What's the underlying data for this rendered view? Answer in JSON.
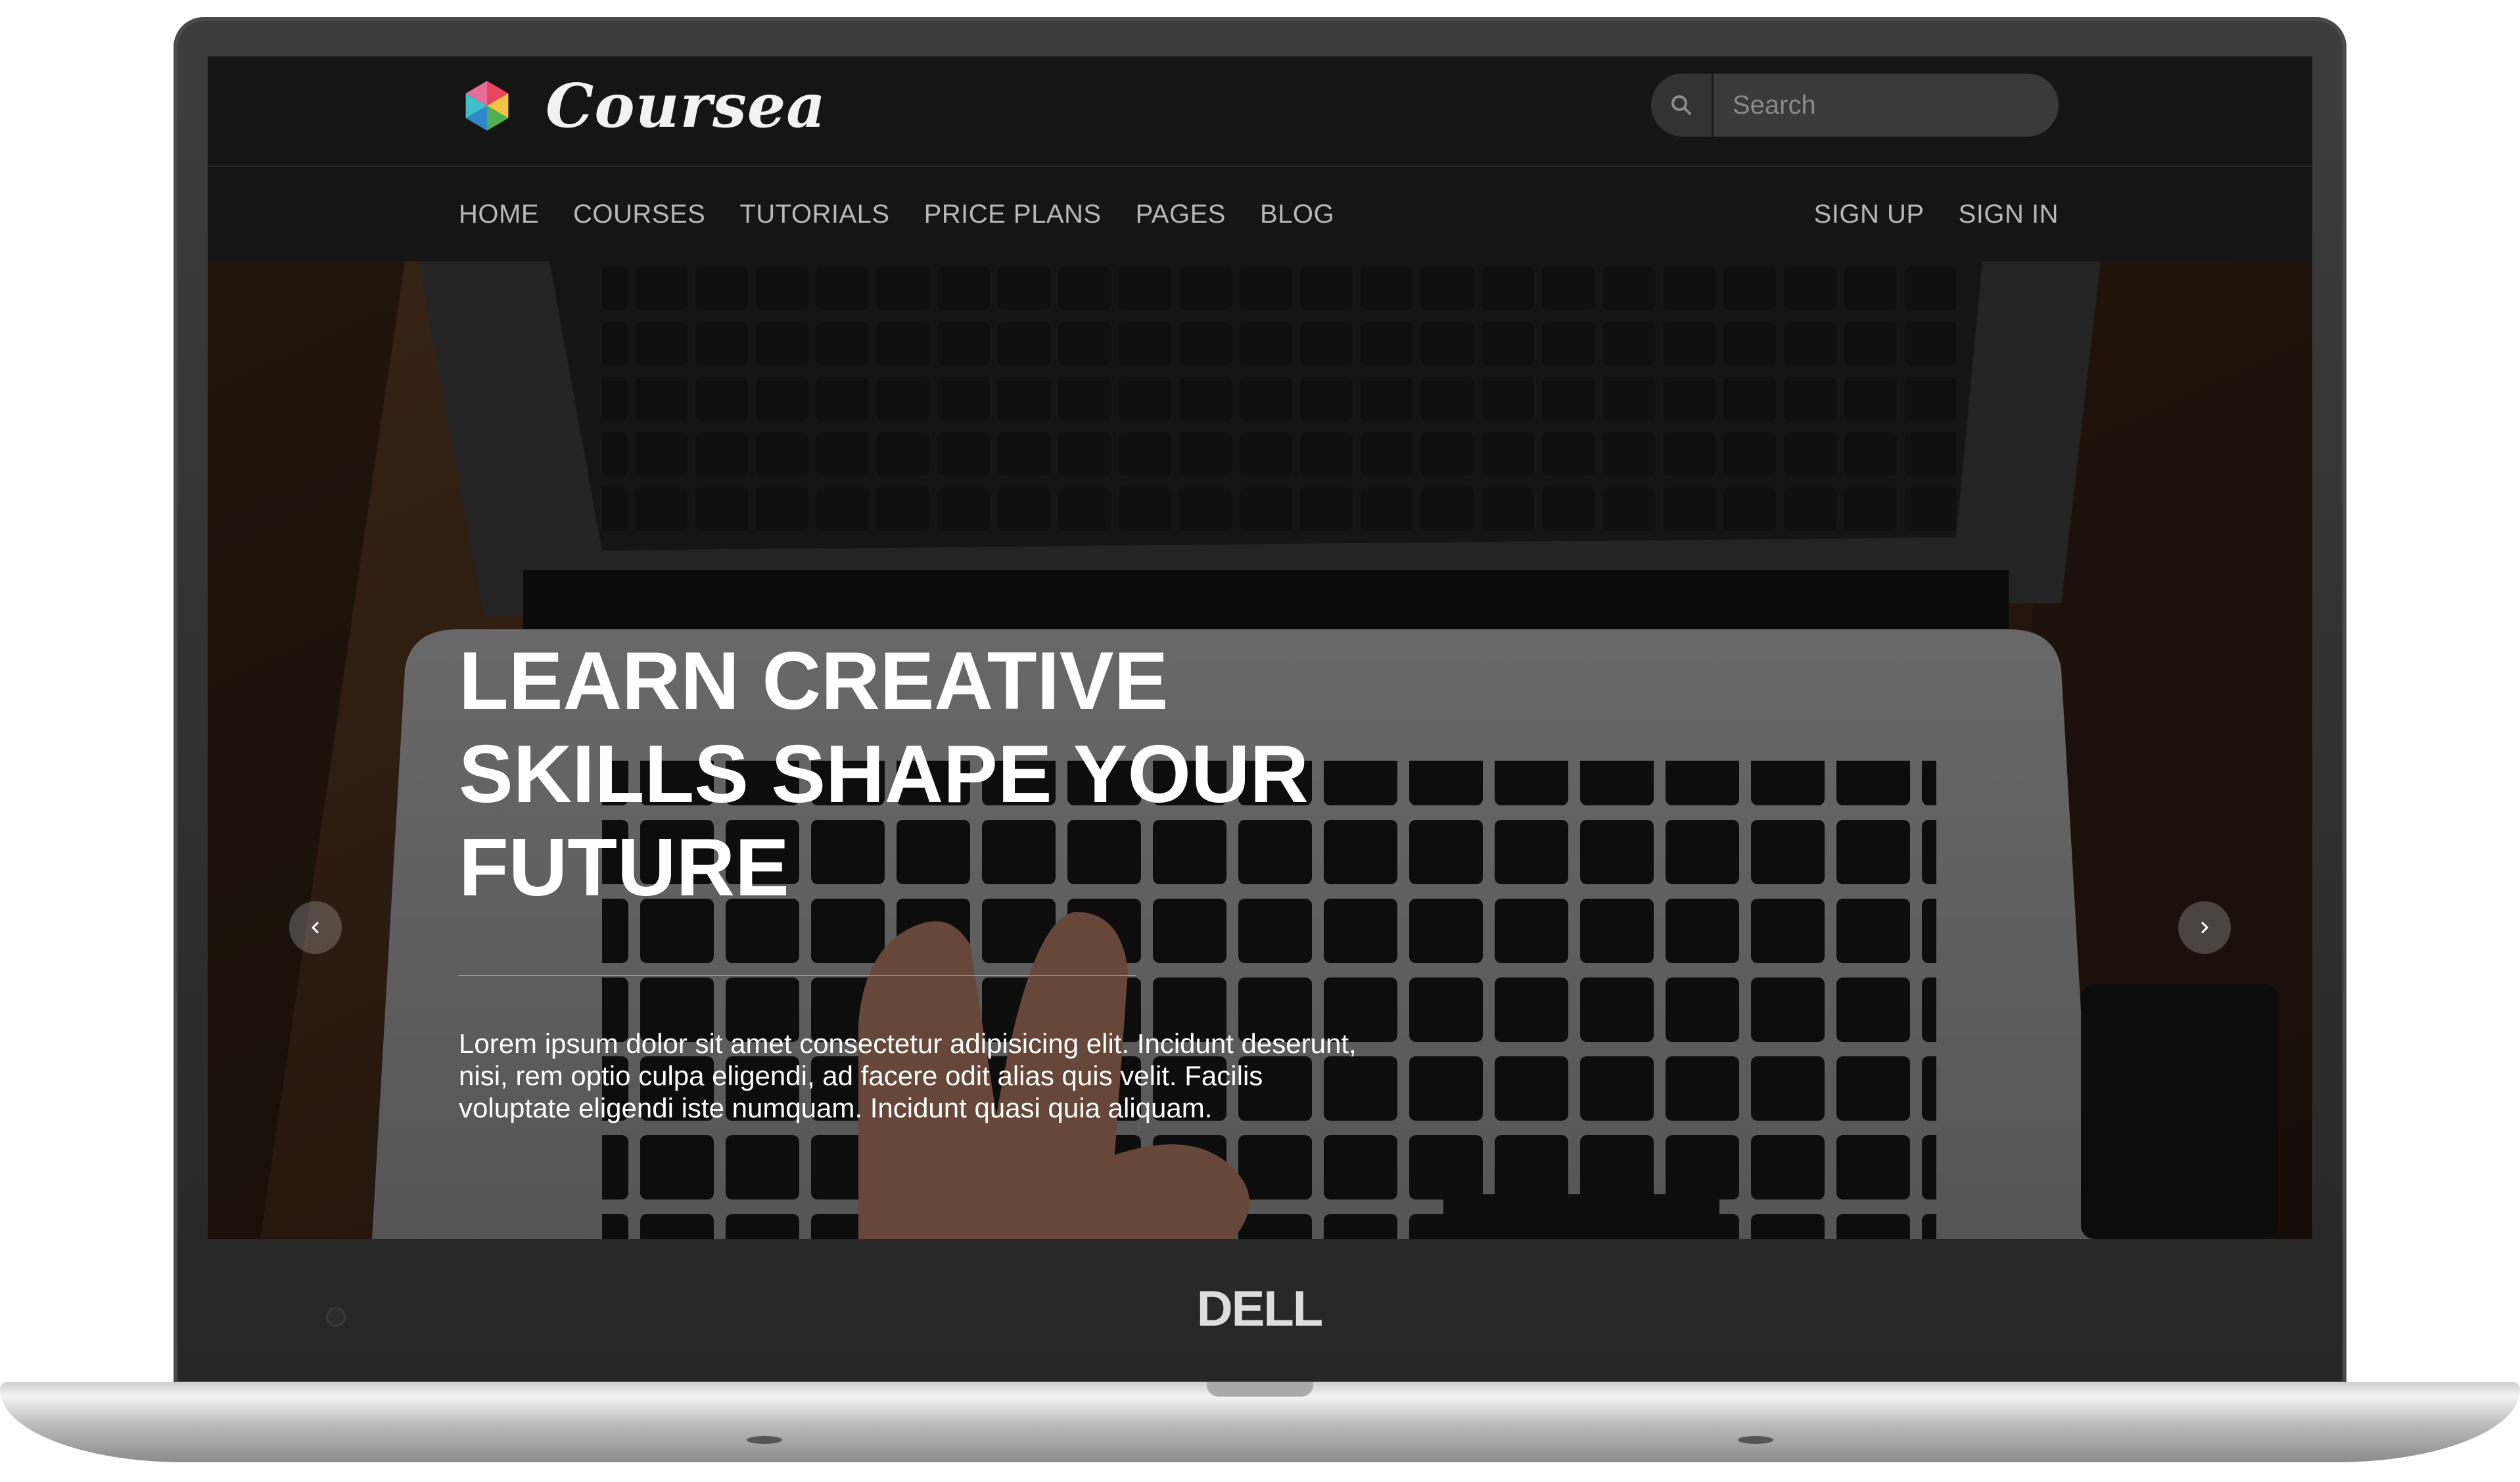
{
  "device": {
    "brand": "DELL"
  },
  "header": {
    "logo_text": "Coursea",
    "search": {
      "placeholder": "Search",
      "value": ""
    }
  },
  "nav": {
    "left": [
      "HOME",
      "COURSES",
      "TUTORIALS",
      "PRICE PLANS",
      "PAGES",
      "BLOG"
    ],
    "right": [
      "SIGN UP",
      "SIGN IN"
    ]
  },
  "hero": {
    "title_lines": [
      "LEARN CREATIVE",
      "SKILLS SHAPE YOUR",
      "FUTURE"
    ],
    "text_lines": [
      "Lorem ipsum dolor sit amet consectetur adipisicing elit. Incidunt deserunt,",
      "nisi, rem optio culpa eligendi, ad facere odit alias quis velit. Facilis",
      "voluptate eligendi iste numquam. Incidunt quasi quia aliquam."
    ],
    "prev_icon": "chevron-left-icon",
    "next_icon": "chevron-right-icon"
  },
  "colors": {
    "header_bg": "#151515",
    "nav_text": "#b7b7b7",
    "search_bg": "#3a3a3a",
    "hero_text": "#ffffff"
  }
}
